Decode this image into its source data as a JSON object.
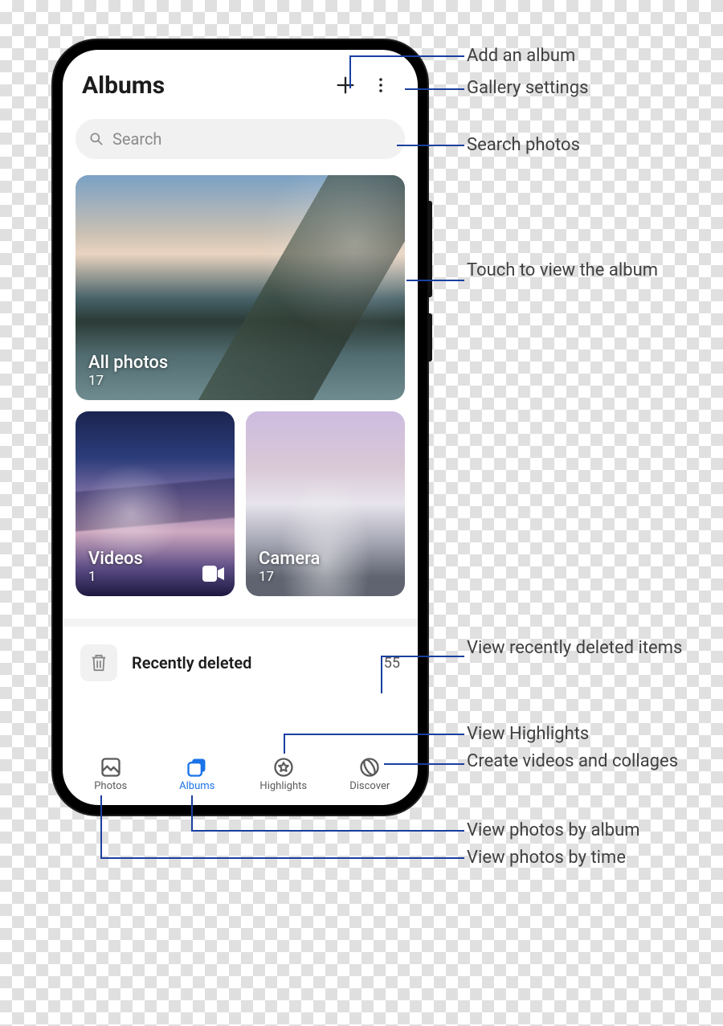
{
  "header": {
    "title": "Albums"
  },
  "search": {
    "placeholder": "Search"
  },
  "albums": {
    "hero": {
      "title": "All photos",
      "count": "17"
    },
    "videos": {
      "title": "Videos",
      "count": "1"
    },
    "camera": {
      "title": "Camera",
      "count": "17"
    }
  },
  "recently_deleted": {
    "label": "Recently deleted",
    "count": "55"
  },
  "nav": {
    "photos": "Photos",
    "albums": "Albums",
    "highlights": "Highlights",
    "discover": "Discover"
  },
  "annotations": {
    "add_album": "Add an album",
    "gallery_settings": "Gallery settings",
    "search_photos": "Search photos",
    "touch_album": "Touch to view the album",
    "view_deleted": "View recently deleted items",
    "view_highlights": "View Highlights",
    "create_collage": "Create videos and collages",
    "by_album": "View photos by album",
    "by_time": "View photos by time"
  }
}
